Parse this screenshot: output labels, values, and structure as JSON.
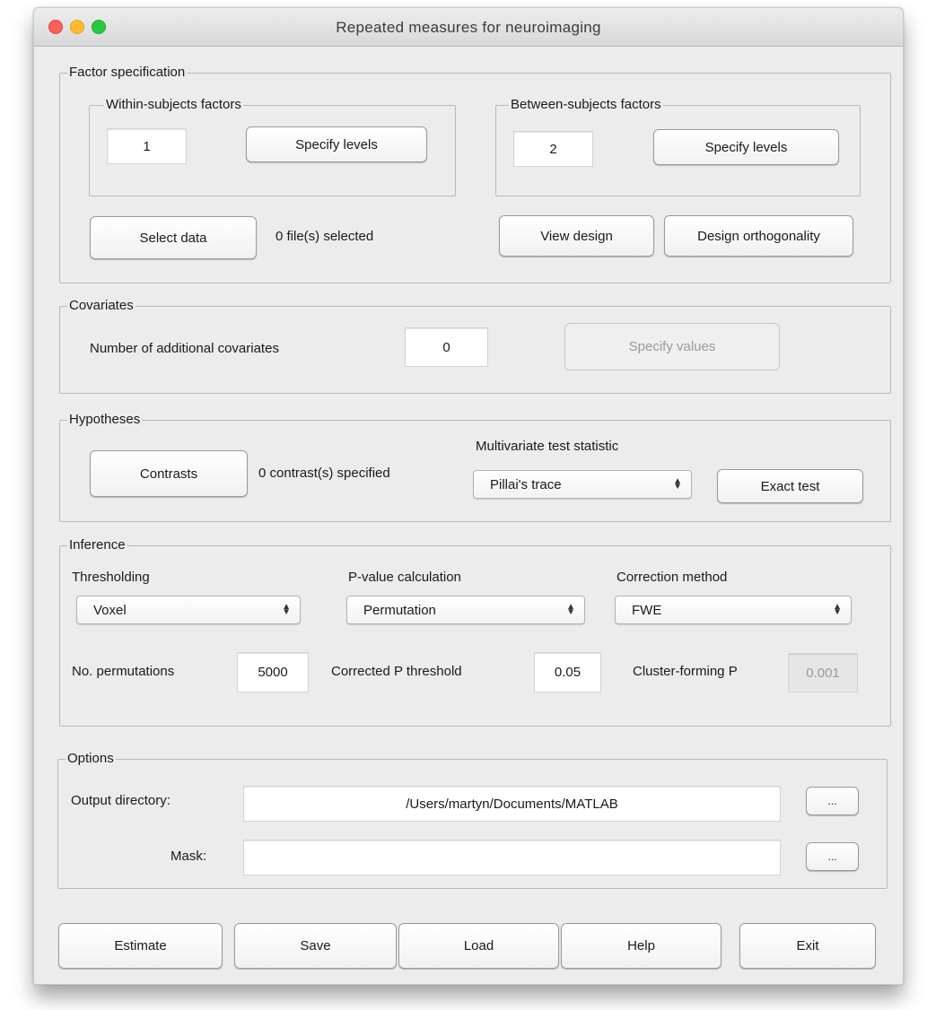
{
  "window": {
    "title": "Repeated measures for neuroimaging"
  },
  "factor_spec": {
    "legend": "Factor specification",
    "within": {
      "legend": "Within-subjects factors",
      "value": "1",
      "button": "Specify levels"
    },
    "between": {
      "legend": "Between-subjects factors",
      "value": "2",
      "button": "Specify levels"
    },
    "select_data": "Select data",
    "files_status": "0 file(s) selected",
    "view_design": "View design",
    "design_orthogonality": "Design orthogonality"
  },
  "covariates": {
    "legend": "Covariates",
    "label": "Number of additional covariates",
    "value": "0",
    "specify_values": "Specify values"
  },
  "hypotheses": {
    "legend": "Hypotheses",
    "contrasts": "Contrasts",
    "contrasts_status": "0 contrast(s) specified",
    "stat_label": "Multivariate test statistic",
    "stat_value": "Pillai's trace",
    "exact_test": "Exact test"
  },
  "inference": {
    "legend": "Inference",
    "thresholding_label": "Thresholding",
    "thresholding_value": "Voxel",
    "pvalue_label": "P-value calculation",
    "pvalue_value": "Permutation",
    "correction_label": "Correction method",
    "correction_value": "FWE",
    "permutations_label": "No. permutations",
    "permutations_value": "5000",
    "corrected_p_label": "Corrected P threshold",
    "corrected_p_value": "0.05",
    "cluster_p_label": "Cluster-forming P",
    "cluster_p_value": "0.001"
  },
  "options": {
    "legend": "Options",
    "output_label": "Output directory:",
    "output_value": "/Users/martyn/Documents/MATLAB",
    "mask_label": "Mask:",
    "mask_value": "",
    "browse": "..."
  },
  "footer": {
    "estimate": "Estimate",
    "save": "Save",
    "load": "Load",
    "help": "Help",
    "exit": "Exit"
  }
}
